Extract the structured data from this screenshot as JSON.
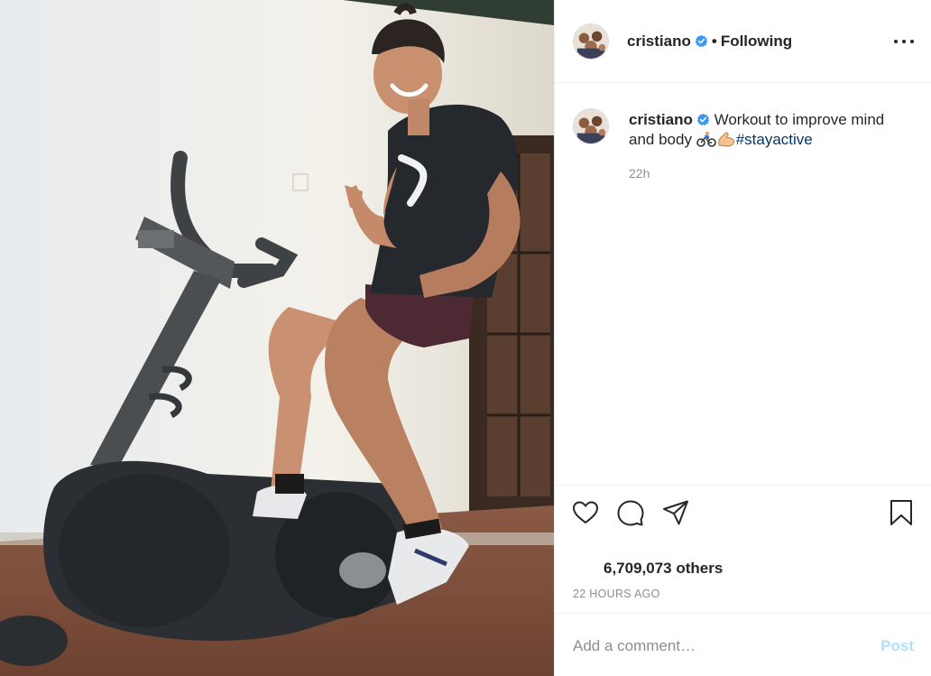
{
  "post": {
    "photo_alt": "Man on stationary exercise bike giving a thumbs up",
    "author": {
      "username": "cristiano",
      "verified": true,
      "follow_status": "Following",
      "separator": "•"
    },
    "caption": {
      "username": "cristiano",
      "text": "Workout to improve mind and body",
      "emojis": [
        "bicyclist-emoji",
        "flexed-biceps-emoji"
      ],
      "hashtag": "#stayactive",
      "time": "22h"
    },
    "likes_text": "6,709,073 others",
    "posted_ago": "22 HOURS AGO",
    "comment_box": {
      "placeholder": "Add a comment…",
      "post_label": "Post"
    },
    "icons": {
      "like": "heart-icon",
      "comment": "comment-icon",
      "share": "share-icon",
      "save": "bookmark-icon",
      "more": "more-options-icon",
      "verified": "verified-badge-icon"
    },
    "colors": {
      "verified_blue": "#3897f0",
      "hashtag": "#00376b",
      "post_disabled": "#b2dffc",
      "secondary_text": "#8e8e8e"
    }
  }
}
